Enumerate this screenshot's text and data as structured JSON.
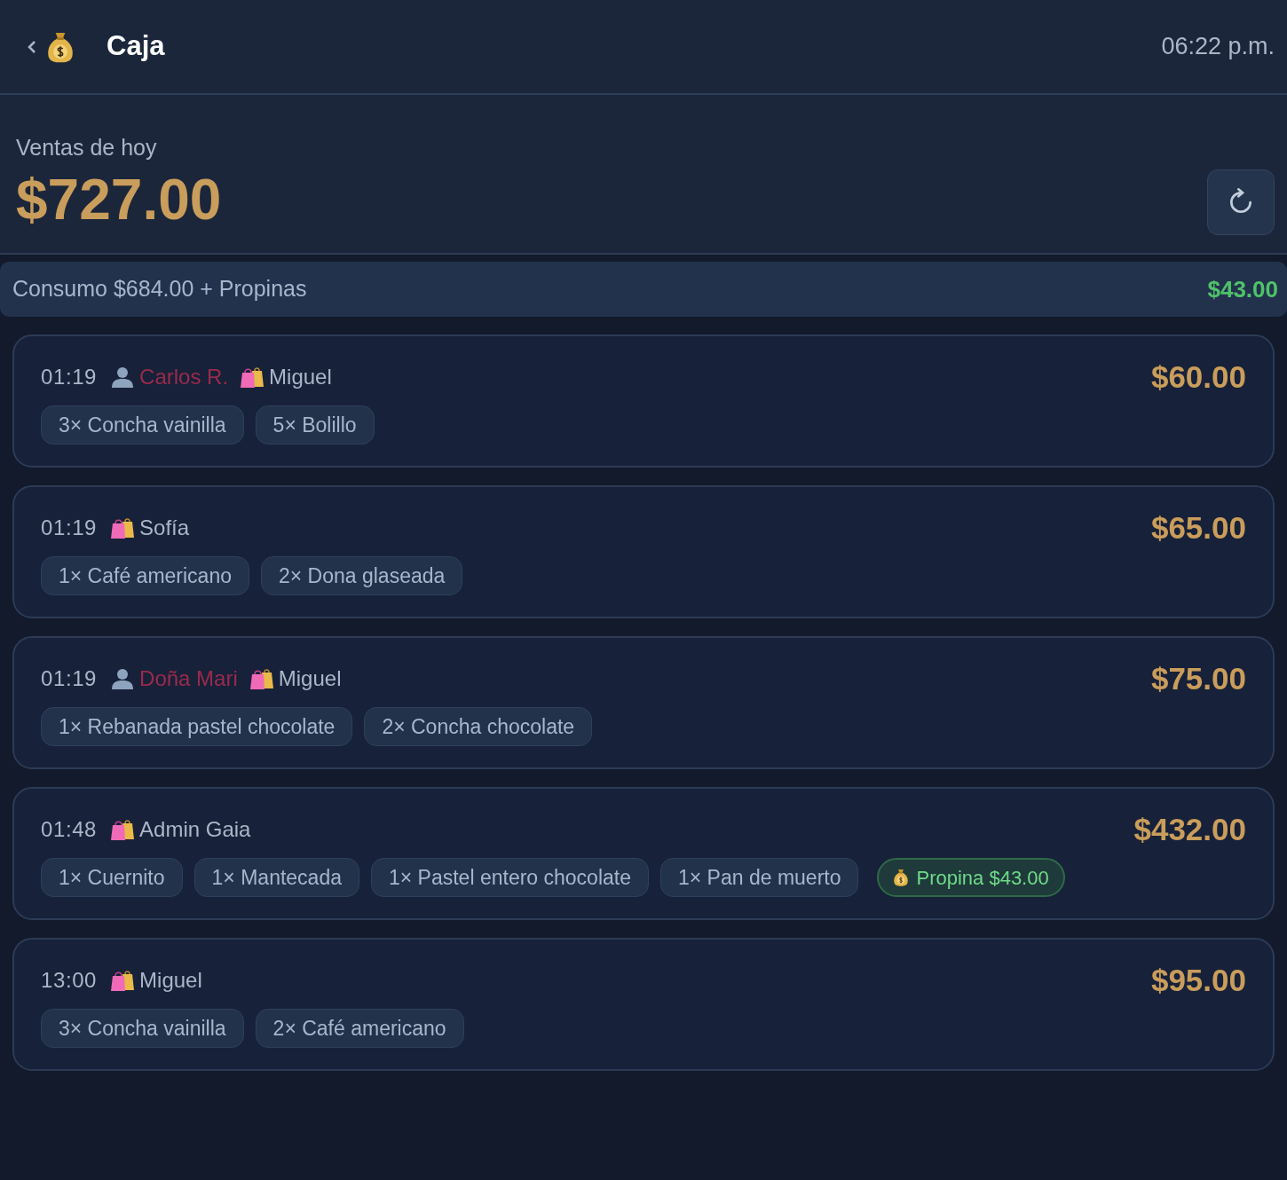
{
  "header": {
    "title": "Caja",
    "time": "06:22 p.m."
  },
  "summary": {
    "label": "Ventas de hoy",
    "total": "$727.00"
  },
  "breakdown": {
    "label": "Consumo $684.00 + Propinas",
    "tips": "$43.00"
  },
  "orders": [
    {
      "time": "01:19",
      "customer": "Carlos R.",
      "seller": "Miguel",
      "total": "$60.00",
      "items": [
        "3× Concha vainilla",
        "5× Bolillo"
      ]
    },
    {
      "time": "01:19",
      "seller": "Sofía",
      "total": "$65.00",
      "items": [
        "1× Café americano",
        "2× Dona glaseada"
      ]
    },
    {
      "time": "01:19",
      "customer": "Doña Mari",
      "seller": "Miguel",
      "total": "$75.00",
      "items": [
        "1× Rebanada pastel chocolate",
        "2× Concha chocolate"
      ]
    },
    {
      "time": "01:48",
      "seller": "Admin Gaia",
      "total": "$432.00",
      "items": [
        "1× Cuernito",
        "1× Mantecada",
        "1× Pastel entero chocolate",
        "1× Pan de muerto"
      ],
      "tip": "Propina $43.00"
    },
    {
      "time": "13:00",
      "seller": "Miguel",
      "total": "$95.00",
      "items": [
        "3× Concha vainilla",
        "2× Café americano"
      ]
    }
  ]
}
